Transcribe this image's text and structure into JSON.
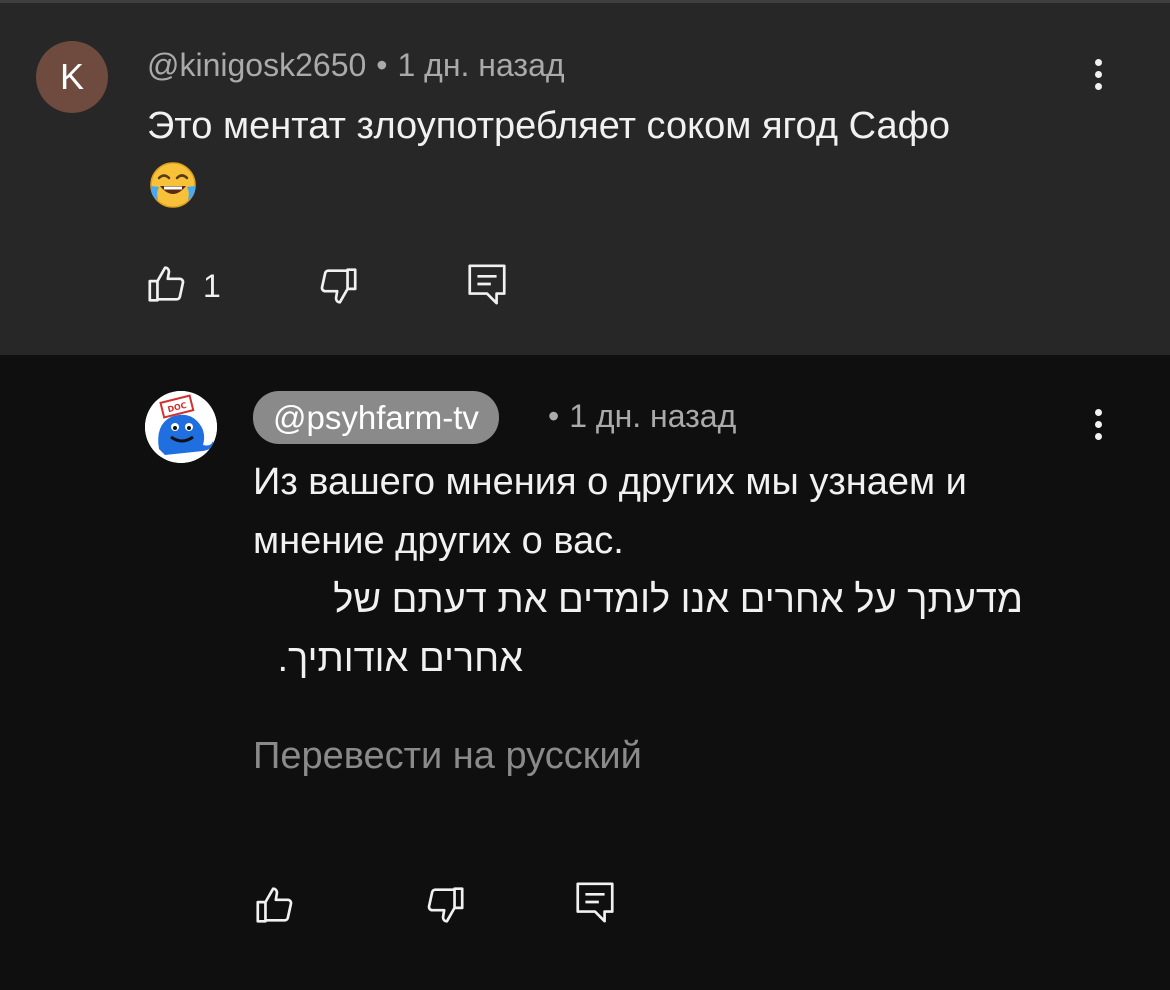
{
  "comments": [
    {
      "avatar_letter": "K",
      "author": "@kinigosk2650",
      "time": "1 дн. назад",
      "text": "Это ментат злоупотребляет соком ягод Сафо",
      "emoji": "😂",
      "likes": "1"
    },
    {
      "author": "@psyhfarm-tv",
      "time": "1 дн. назад",
      "text_lines": [
        "Из вашего мнения о других мы узнаем и",
        "мнение других о вас.",
        "מדעתך על אחרים אנו לומדים את דעתם של",
        "אחרים אודותיך."
      ],
      "translate_label": "Перевести на русский",
      "avatar_badge": "DOC"
    }
  ],
  "separator": "•",
  "colors": {
    "parent_bg": "#272727",
    "reply_bg": "#0f0f0f",
    "text": "#f1f1f1",
    "meta": "#aaaaaa",
    "avatar_k": "#6e4b3e",
    "author_chip": "#8a8a8a"
  },
  "icons": [
    "like-icon",
    "dislike-icon",
    "reply-icon",
    "more-vertical-icon"
  ]
}
